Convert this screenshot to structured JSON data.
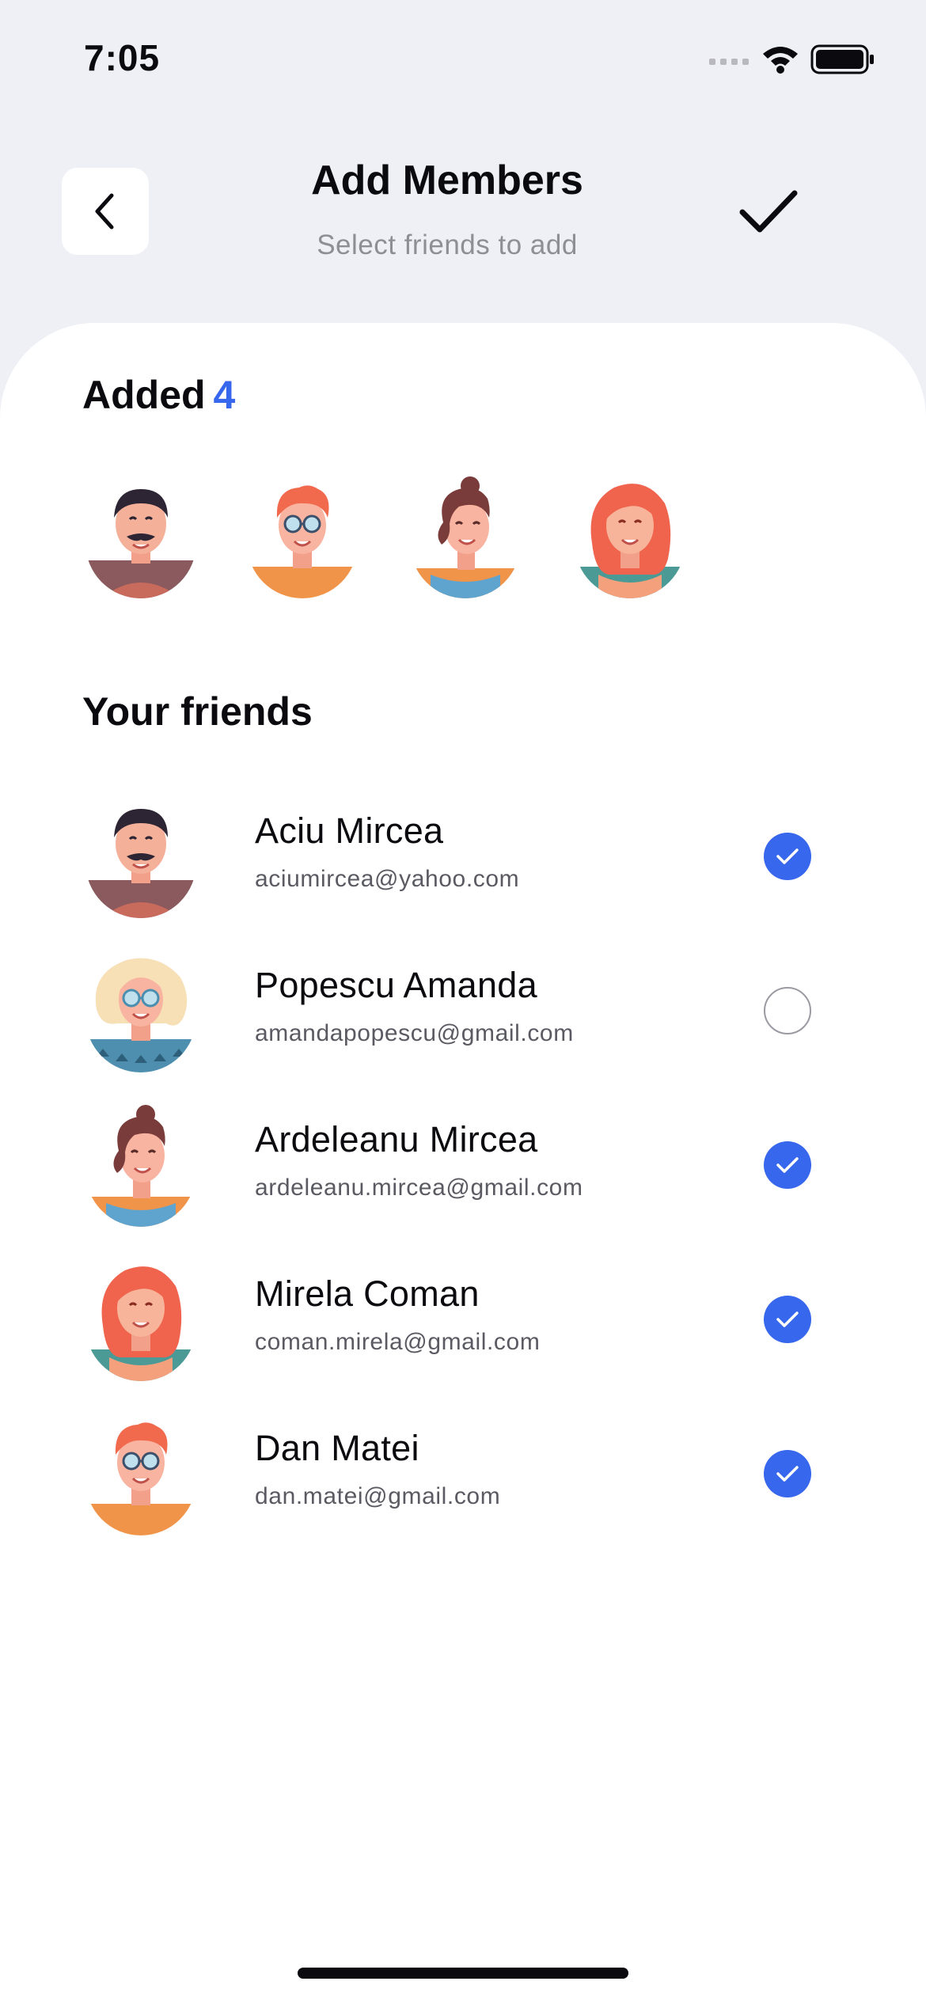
{
  "status": {
    "time": "7:05"
  },
  "header": {
    "title": "Add Members",
    "subtitle": "Select friends to add"
  },
  "added": {
    "label": "Added",
    "count": "4",
    "avatars": [
      "avatar-mustache-man",
      "avatar-redhead-glasses-man",
      "avatar-brunette-woman",
      "avatar-redhead-woman"
    ]
  },
  "friends": {
    "label": "Your friends",
    "items": [
      {
        "name": "Aciu Mircea",
        "email": "aciumircea@yahoo.com",
        "selected": true,
        "avatar": "avatar-mustache-man"
      },
      {
        "name": "Popescu Amanda",
        "email": "amandapopescu@gmail.com",
        "selected": false,
        "avatar": "avatar-blonde-glasses-woman"
      },
      {
        "name": "Ardeleanu Mircea",
        "email": "ardeleanu.mircea@gmail.com",
        "selected": true,
        "avatar": "avatar-brunette-woman"
      },
      {
        "name": "Mirela Coman",
        "email": "coman.mirela@gmail.com",
        "selected": true,
        "avatar": "avatar-redhead-woman"
      },
      {
        "name": "Dan Matei",
        "email": "dan.matei@gmail.com",
        "selected": true,
        "avatar": "avatar-redhead-glasses-man"
      }
    ]
  },
  "colors": {
    "accent": "#3767ec",
    "background": "#eef0f5",
    "sheet": "#ffffff"
  }
}
